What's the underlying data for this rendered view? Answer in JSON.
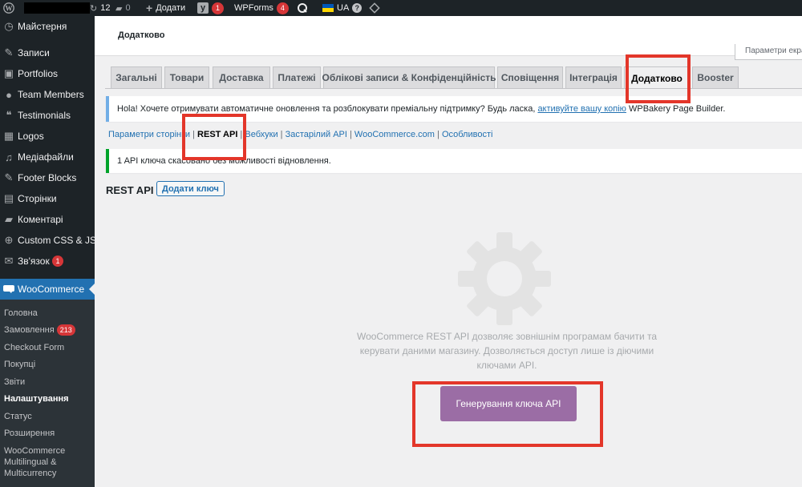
{
  "admin_bar": {
    "updates_count": "12",
    "comments_count": "0",
    "new_label": "Додати",
    "yoast_count": "1",
    "wpforms_label": "WPForms",
    "wpforms_count": "4",
    "language": "UA"
  },
  "sidebar": {
    "items": [
      {
        "label": "Майстерня",
        "icon": "dashboard-icon",
        "glyph": "◷"
      },
      {
        "label": "Записи",
        "icon": "pin-icon",
        "glyph": "✎"
      },
      {
        "label": "Portfolios",
        "icon": "image-icon",
        "glyph": "▣"
      },
      {
        "label": "Team Members",
        "icon": "user-icon",
        "glyph": "●"
      },
      {
        "label": "Testimonials",
        "icon": "quote-icon",
        "glyph": "❝"
      },
      {
        "label": "Logos",
        "icon": "grid-icon",
        "glyph": "▦"
      },
      {
        "label": "Медіафайли",
        "icon": "media-icon",
        "glyph": "♫"
      },
      {
        "label": "Footer Blocks",
        "icon": "pin-icon",
        "glyph": "✎"
      },
      {
        "label": "Сторінки",
        "icon": "pages-icon",
        "glyph": "▤"
      },
      {
        "label": "Коментарі",
        "icon": "comment-icon",
        "glyph": "▰"
      },
      {
        "label": "Custom CSS & JS",
        "icon": "plus-circle-icon",
        "glyph": "⊕"
      },
      {
        "label": "Зв'язок",
        "icon": "mail-icon",
        "glyph": "✉",
        "badge": "1"
      },
      {
        "label": "WooCommerce",
        "icon": "woo-icon",
        "glyph": "▬"
      }
    ],
    "submenu": [
      {
        "label": "Головна"
      },
      {
        "label": "Замовлення",
        "badge": "213"
      },
      {
        "label": "Checkout Form"
      },
      {
        "label": "Покупці"
      },
      {
        "label": "Звіти"
      },
      {
        "label": "Налаштування",
        "current": true
      },
      {
        "label": "Статус"
      },
      {
        "label": "Розширення"
      },
      {
        "label": "WooCommerce Multilingual & Multicurrency"
      }
    ]
  },
  "page": {
    "title": "Додатково",
    "screen_options": "Параметри екрану"
  },
  "tabs": [
    {
      "label": "Загальні"
    },
    {
      "label": "Товари"
    },
    {
      "label": "Доставка"
    },
    {
      "label": "Платежі"
    },
    {
      "label": "Облікові записи & Конфіденційність"
    },
    {
      "label": "Сповіщення"
    },
    {
      "label": "Інтеграція"
    },
    {
      "label": "Додатково",
      "active": true
    },
    {
      "label": "Booster"
    }
  ],
  "notice_update": {
    "text_before": "Hola! Хочете отримувати автоматичне оновлення та розблокувати преміальну підтримку? Будь ласка, ",
    "link": "активуйте вашу копію",
    "text_after": " WPBakery Page Builder."
  },
  "subsections": {
    "page_setup": "Параметри сторінки",
    "rest_api": "REST API",
    "webhooks": "Вебхуки",
    "legacy_api": "Застарілий API",
    "woocommerce_com": "WooCommerce.com",
    "features": "Особливості"
  },
  "notice_success": "1 API ключа скасовано без можливості відновлення.",
  "rest_api": {
    "heading": "REST API",
    "add_key": "Додати ключ",
    "blank_state": "WooCommerce REST API дозволяє зовнішнім програмам бачити та керувати даними магазину. Дозволяється доступ лише із діючими ключами API.",
    "generate_button": "Генерування ключа API"
  },
  "colors": {
    "highlight": "#e3362a",
    "woo_purple": "#9b6da5",
    "admin_blue": "#2271b1"
  }
}
